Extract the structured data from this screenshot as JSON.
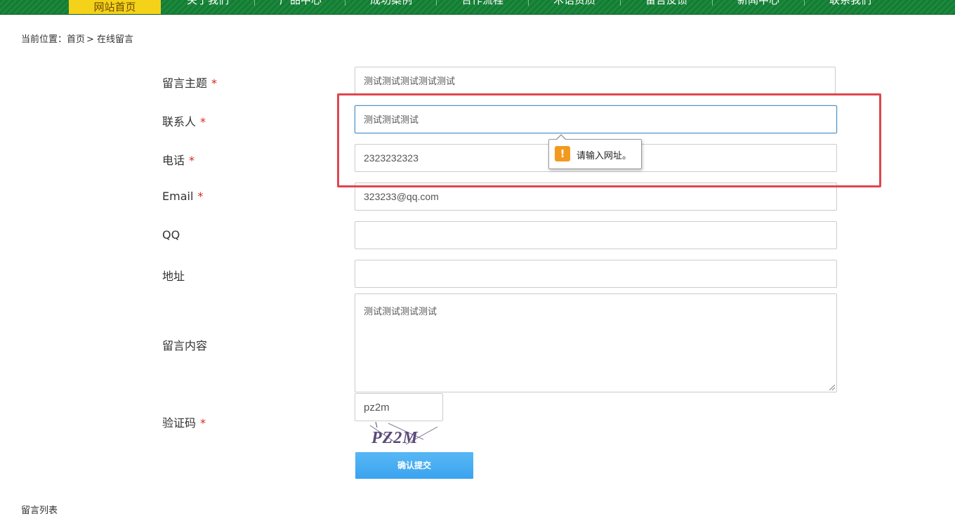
{
  "nav": {
    "items": [
      "网站首页",
      "关于我们",
      "产品中心",
      "成功案例",
      "合作流程",
      "术语资质",
      "留言反馈",
      "新闻中心",
      "联系我们"
    ]
  },
  "breadcrumb": {
    "prefix": "当前位置：",
    "home": "首页",
    "arrow": ">",
    "current": "在线留言"
  },
  "form": {
    "required_mark": "*",
    "subject": {
      "label": "留言主题",
      "value": "测试测试测试测试测试"
    },
    "contact": {
      "label": "联系人",
      "value": "测试测试测试"
    },
    "phone": {
      "label": "电话",
      "value": "2323232323"
    },
    "email": {
      "label": "Email",
      "value": "323233@qq.com"
    },
    "qq": {
      "label": "QQ",
      "value": ""
    },
    "address": {
      "label": "地址",
      "value": ""
    },
    "content": {
      "label": "留言内容",
      "value": "测试测试测试测试"
    },
    "captcha": {
      "label": "验证码",
      "value": "pz2m",
      "image_text": "PZ2M"
    },
    "submit_label": "确认提交"
  },
  "validation_tooltip": {
    "icon": "warning-icon",
    "message": "请输入网址。"
  },
  "message_list": {
    "title": "留言列表"
  },
  "colors": {
    "nav_green": "#1a8a3c",
    "nav_active": "#f5d21a",
    "required": "#d9261c",
    "submit_blue": "#3aa3ef",
    "annotation_red": "#e0464d",
    "warning_orange": "#f29a1f"
  }
}
